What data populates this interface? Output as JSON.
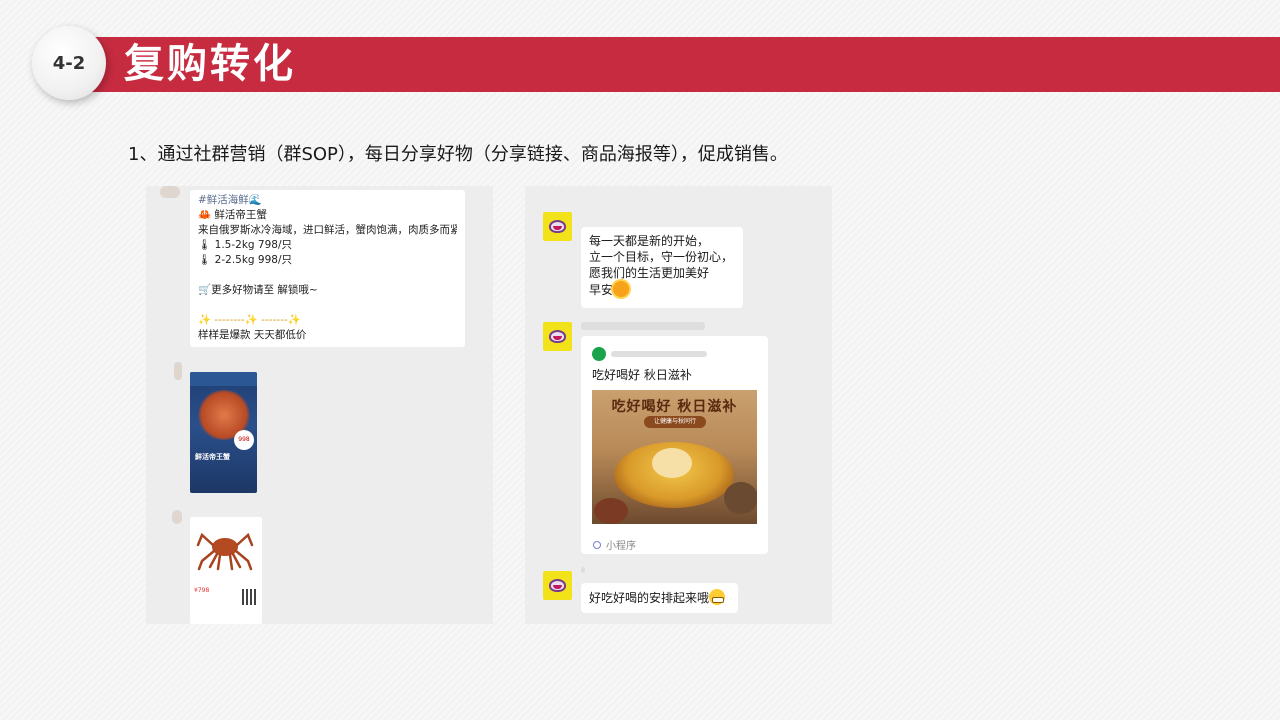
{
  "header": {
    "section_number": "4-2",
    "title": "复购转化",
    "color_bar": "#c62b40"
  },
  "subtitle": "1、通过社群营销（群SOP），每日分享好物（分享链接、商品海报等），促成销售。",
  "left_chat": {
    "card_lines": [
      "#鲜活海鲜🌊",
      "🦀 鲜活帝王蟹",
      "来自俄罗斯冰冷海域，进口鲜活，蟹肉饱满，肉质多而紧实",
      "🌡 1.5-2kg   798/只",
      "🌡 2-2.5kg   998/只",
      "",
      "🛒更多好物请至              解锁哦~",
      "",
      "✨ --------✨ -------✨",
      "样样是爆款 天天都低价"
    ],
    "poster1": {
      "price": "998",
      "name": "鲜活帝王蟹"
    },
    "poster2": {
      "price": "¥798"
    }
  },
  "right_chat": {
    "message1_lines": [
      "每一天都是新的开始，",
      "立一个目标，守一份初心，",
      "愿我们的生活更加美好",
      "早安"
    ],
    "mini_program": {
      "title": "吃好喝好  秋日滋补",
      "image_heading": "吃好喝好  秋日滋补",
      "image_tag": "让健康与秋同行",
      "footer": "小程序"
    },
    "message3": "好吃好喝的安排起来哦"
  }
}
